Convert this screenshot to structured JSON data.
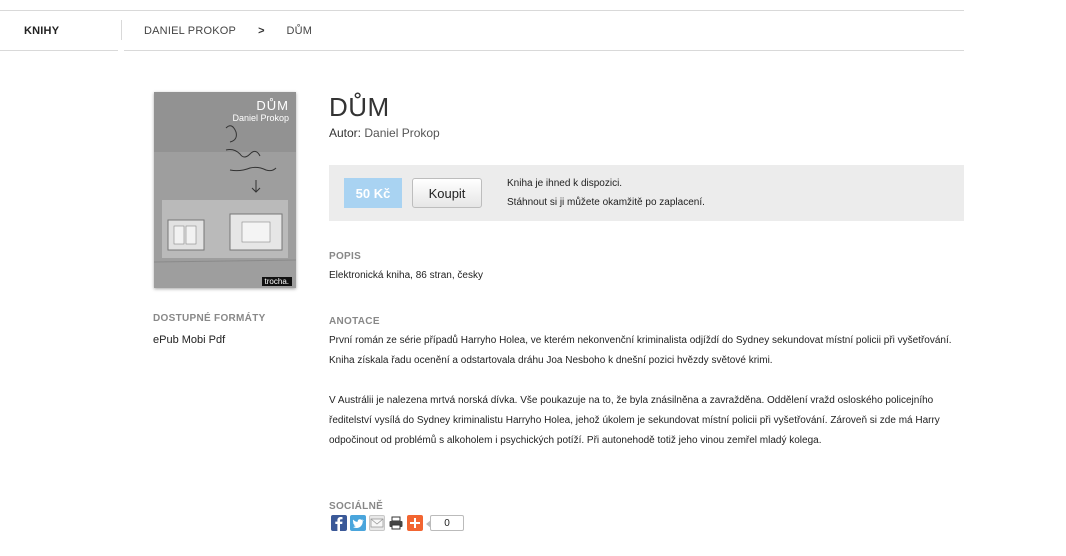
{
  "nav": {
    "home": "KNIHY",
    "breadcrumb": [
      "DANIEL PROKOP",
      "DŮM"
    ],
    "separator": ">"
  },
  "book": {
    "cover": {
      "title": "DŮM",
      "author": "Daniel Prokop",
      "publisher": "trocha."
    },
    "title": "DŮM",
    "author_label": "Autor:",
    "author_name": "Daniel Prokop",
    "formats_label": "DOSTUPNÉ FORMÁTY",
    "formats": "ePub Mobi Pdf"
  },
  "purchase": {
    "price": "50 Kč",
    "buy_label": "Koupit",
    "availability_line1": "Kniha je ihned k dispozici.",
    "availability_line2": "Stáhnout si ji můžete okamžitě po zaplacení."
  },
  "description": {
    "label": "POPIS",
    "text": "Elektronická kniha, 86 stran, česky"
  },
  "annotation": {
    "label": "ANOTACE",
    "paragraph1": "První román ze série případů Harryho Holea, ve kterém nekonvenční kriminalista odjíždí do Sydney sekundovat místní policii při vyšetřování. Kniha získala řadu ocenění a odstartovala dráhu Joa Nesboho k dnešní pozici hvězdy světové krimi.",
    "paragraph2": "V Austrálii je nalezena mrtvá norská dívka. Vše poukazuje na to, že byla znásilněna a zavražděna. Oddělení vražd osloského policejního ředitelství vysílá do Sydney kriminalistu Harryho Holea, jehož úkolem je sekundovat místní policii při vyšetřování. Zároveň si zde má Harry odpočinout od problémů s alkoholem i psychických potíží. Při autonehodě totiž jeho vinou zemřel mladý kolega."
  },
  "social": {
    "label": "SOCIÁLNĚ",
    "icons": [
      "facebook-icon",
      "twitter-icon",
      "mail-icon",
      "print-icon",
      "share-plus-icon"
    ],
    "share_count": "0"
  },
  "colors": {
    "price_bg": "#a9d3f2",
    "buybox_bg": "#ececec",
    "label_gray": "#888888"
  }
}
